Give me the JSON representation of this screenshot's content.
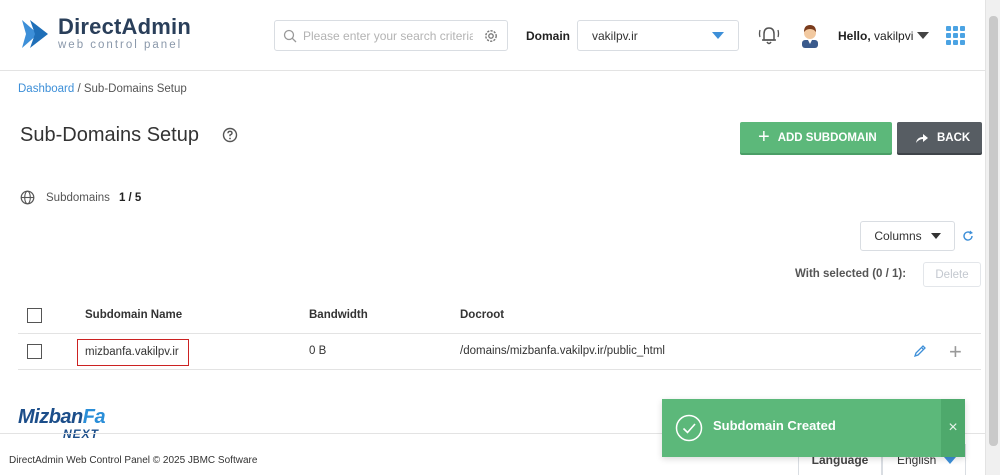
{
  "app": {
    "name": "DirectAdmin",
    "tagline": "web control panel"
  },
  "header": {
    "search_placeholder": "Please enter your search criteria",
    "domain_label": "Domain",
    "domain_value": "vakilpv.ir",
    "hello_prefix": "Hello,",
    "username": "vakilpvi"
  },
  "breadcrumb": {
    "link": "Dashboard",
    "current": " / Sub-Domains Setup"
  },
  "page": {
    "title": "Sub-Domains Setup",
    "add_button": "ADD SUBDOMAIN",
    "back_button": "BACK",
    "subdomains_label": "Subdomains",
    "subdomains_count": "1 / 5",
    "columns_button": "Columns",
    "with_selected": "With selected (0 / 1):",
    "delete_button": "Delete"
  },
  "table": {
    "headers": [
      "Subdomain Name",
      "Bandwidth",
      "Docroot"
    ],
    "rows": [
      {
        "name": "mizbanfa.vakilpv.ir",
        "bandwidth": "0 B",
        "docroot": "/domains/mizbanfa.vakilpv.ir/public_html"
      }
    ]
  },
  "footer": {
    "brand_top_a": "Mizban",
    "brand_top_b": "Fa",
    "brand_bottom": "NEXT",
    "copyright": "DirectAdmin Web Control Panel © 2025 JBMC Software",
    "language_label": "Language",
    "language_value": "English"
  },
  "toast": {
    "message": "Subdomain Created",
    "close": "×"
  },
  "colors": {
    "accent": "#3d8fd8",
    "success": "#5cb87a",
    "back_button": "#575d63",
    "highlight_border": "#cc2222"
  }
}
